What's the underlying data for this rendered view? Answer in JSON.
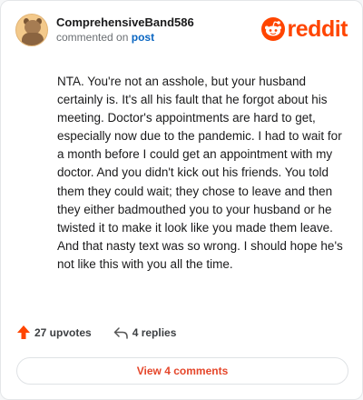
{
  "comment": {
    "username": "ComprehensiveBand586",
    "commented_on_prefix": "commented on",
    "commented_on_link": "post",
    "body": "NTA. You're not an asshole, but your husband certainly is. It's all his fault that he forgot about his meeting. Doctor's appointments are hard to get, especially now due to the pandemic. I had to wait for a month before I could get an appointment with my doctor. And you didn't kick out his friends. You told them they could wait; they chose to leave and then they either badmouthed you to your husband or he twisted it to make it look like you made them leave. And that nasty text was so wrong. I should hope he's not like this with you all the time."
  },
  "brand": {
    "name": "reddit",
    "color": "#ff4500"
  },
  "actions": {
    "upvotes": "27 upvotes",
    "replies": "4 replies"
  },
  "footer": {
    "view_comments": "View 4 comments"
  },
  "icons": {
    "avatar": "snoo-avatar-icon",
    "logo": "reddit-snoo-icon",
    "upvote": "upvote-arrow-icon",
    "reply": "reply-arrow-icon"
  }
}
